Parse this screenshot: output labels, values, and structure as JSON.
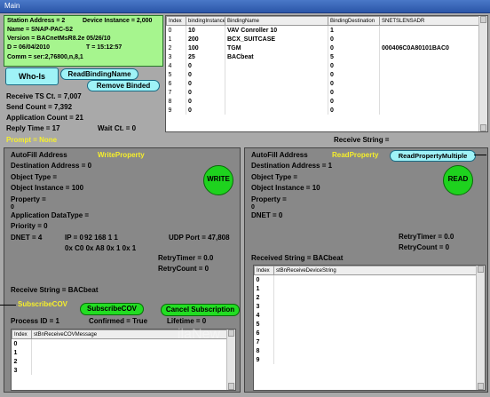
{
  "window": {
    "title": "Main"
  },
  "info": {
    "station_address": "Station Address = 2",
    "device_instance": "Device Instance = 2,000",
    "name": "Name = SNAP-PAC-S2",
    "version": "Version = BACnetMsR8.2e 05/26/10",
    "date": "D = 06/04/2010",
    "time": "T = 15:12:57",
    "comm": "Comm = ser:2,76800,n,8,1"
  },
  "buttons": {
    "who_is": "Who-Is",
    "read_binding_name": "ReadBindingName",
    "remove_binded": "Remove Binded",
    "write_property": "WriteProperty",
    "write": "WRITE",
    "read_property": "ReadProperty",
    "read_property_multiple": "ReadPropertyMultiple",
    "read": "READ",
    "subscribe_cov_label": "SubscribeCOV",
    "subscribe_cov": "SubscribeCOV",
    "cancel_subscription": "Cancel Subscription"
  },
  "stats": {
    "receive_ts_ct": "Receive TS Ct. = 7,007",
    "send_count": "Send Count = 7,392",
    "application_count": "Application Count = 21",
    "reply_time": "Reply Time = 17",
    "wait_ct": "Wait Ct. = 0",
    "prompt": "Prompt = None",
    "receive_string_top": "Receive String ="
  },
  "binding_table": {
    "headers": [
      "Index",
      "bindingInstance",
      "BindingName",
      "BindingDestination",
      "SNETSLENSADR"
    ],
    "rows": [
      [
        "0",
        "10",
        "VAV Conroller 10",
        "1",
        ""
      ],
      [
        "1",
        "200",
        "BCX_SUITCASE",
        "0",
        ""
      ],
      [
        "2",
        "100",
        "TGM",
        "0",
        "000406C0A80101BAC0"
      ],
      [
        "3",
        "25",
        "BACbeat",
        "5",
        ""
      ],
      [
        "4",
        "0",
        "",
        "0",
        ""
      ],
      [
        "5",
        "0",
        "",
        "0",
        ""
      ],
      [
        "6",
        "0",
        "",
        "0",
        ""
      ],
      [
        "7",
        "0",
        "",
        "0",
        ""
      ],
      [
        "8",
        "0",
        "",
        "0",
        ""
      ],
      [
        "9",
        "0",
        "",
        "0",
        ""
      ]
    ]
  },
  "write_panel": {
    "autofill": "AutoFill Address",
    "destination_address": "Destination Address = 0",
    "object_type": "Object Type =",
    "object_instance": "Object Instance = 100",
    "property": "Property =",
    "property_value": "0",
    "application_datatype": "Application DataType =",
    "priority": "Priority = 0",
    "dnet": "DNET = 4",
    "ip_label": "IP = 0",
    "ip_values": "92 168 1    1",
    "hex_values": "0x C0   0x A8   0x 1    0x 1",
    "udp_port": "UDP Port = 47,808",
    "retry_timer": "RetryTimer = 0.0",
    "retry_count": "RetryCount = 0",
    "receive_string": "Receive String = BACbeat"
  },
  "cov": {
    "process_id": "Process ID = 1",
    "confirmed": "Confirmed = True",
    "lifetime": "Lifetime = 0",
    "headers": [
      "Index",
      "stBnReceiveCOVMessage"
    ],
    "rows": [
      "0",
      "1",
      "2",
      "3"
    ]
  },
  "read_panel": {
    "autofill": "AutoFill Address",
    "destination_address": "Destination Address = 1",
    "object_type": "Object Type =",
    "object_instance": "Object Instance = 10",
    "property": "Property =",
    "property_value": "0",
    "dnet": "DNET = 0",
    "retry_timer": "RetryTimer = 0.0",
    "retry_count": "RetryCount = 0",
    "received_string": "Received String = BACbeat",
    "headers": [
      "Index",
      "stBnReceiveDeviceString"
    ],
    "rows": [
      "0",
      "1",
      "2",
      "3",
      "4",
      "5",
      "6",
      "7",
      "8",
      "9"
    ]
  },
  "watermark": "ilaNew",
  "colors": {
    "background": "#a9a9a9",
    "info_green": "#a6f58e",
    "button_cyan": "#9ff3f7",
    "action_green": "#1ed21e",
    "label_yellow": "#f6ef2b",
    "titlebar_blue": "#2b56a8"
  }
}
